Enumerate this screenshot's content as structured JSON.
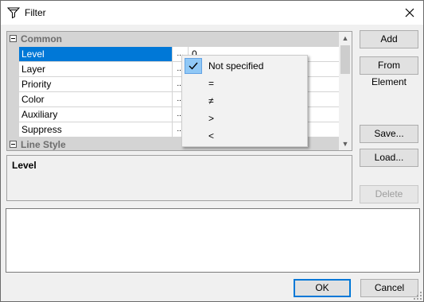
{
  "window": {
    "title": "Filter",
    "icon": "funnel-icon",
    "close_icon": "close-icon"
  },
  "grid": {
    "categories": [
      {
        "label": "Common"
      },
      {
        "label": "Line Style"
      }
    ],
    "properties": [
      {
        "name": "Level",
        "button": "...",
        "value": "0"
      },
      {
        "name": "Layer",
        "button": "...",
        "value": ""
      },
      {
        "name": "Priority",
        "button": "...",
        "value": ""
      },
      {
        "name": "Color",
        "button": "...",
        "value": ""
      },
      {
        "name": "Auxiliary",
        "button": "...",
        "value": ""
      },
      {
        "name": "Suppress",
        "button": "...",
        "value": ""
      }
    ],
    "selected_property": "Level"
  },
  "description": {
    "title": "Level"
  },
  "dropdown_menu": {
    "items": [
      {
        "label": "Not specified",
        "checked": true
      },
      {
        "label": "=",
        "checked": false
      },
      {
        "label": "≠",
        "checked": false
      },
      {
        "label": ">",
        "checked": false
      },
      {
        "label": "<",
        "checked": false
      }
    ]
  },
  "side_buttons": {
    "add": "Add",
    "from_element": "From Element",
    "save": "Save...",
    "load": "Load...",
    "delete": "Delete"
  },
  "footer": {
    "ok": "OK",
    "cancel": "Cancel"
  },
  "text_area": {
    "value": ""
  }
}
